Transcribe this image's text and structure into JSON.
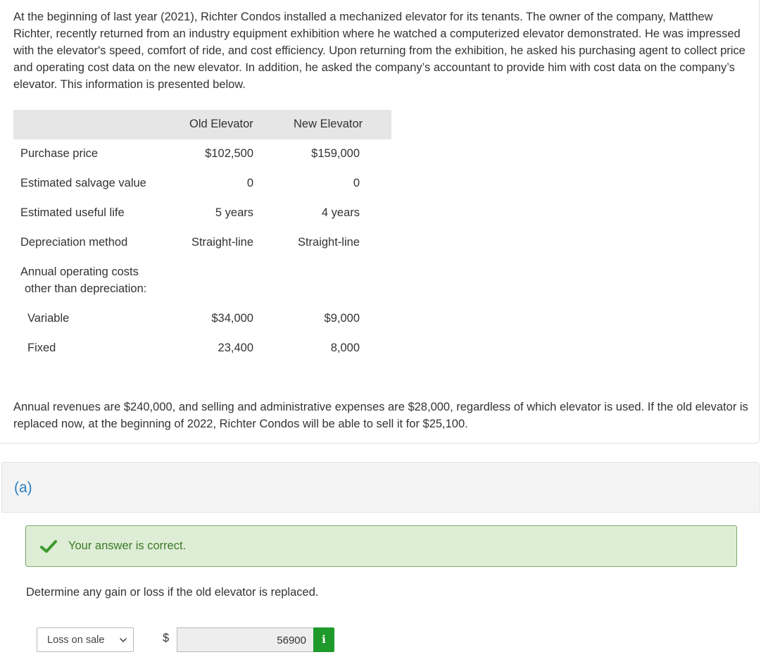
{
  "intro_text": "At the beginning of last year (2021), Richter Condos installed a mechanized elevator for its tenants. The owner of the company, Matthew Richter, recently returned from an industry equipment exhibition where he watched a computerized elevator demonstrated. He was impressed with the elevator's speed, comfort of ride, and cost efficiency. Upon returning from the exhibition, he asked his purchasing agent to collect price and operating cost data on the new elevator. In addition, he asked the company’s accountant to provide him with cost data on the company’s elevator. This information is presented below.",
  "table": {
    "col_old": "Old Elevator",
    "col_new": "New Elevator",
    "rows": [
      {
        "label": "Purchase price",
        "old": "$102,500",
        "new": "$159,000"
      },
      {
        "label": "Estimated salvage value",
        "old": "0",
        "new": "0"
      },
      {
        "label": "Estimated useful life",
        "old": "5 years",
        "new": "4 years"
      },
      {
        "label": "Depreciation method",
        "old": "Straight-line",
        "new": "Straight-line"
      },
      {
        "label": "Annual operating costs",
        "old": "",
        "new": ""
      },
      {
        "label": "other than depreciation:",
        "old": "",
        "new": ""
      },
      {
        "label": "Variable",
        "old": "$34,000",
        "new": "$9,000"
      },
      {
        "label": "Fixed",
        "old": "23,400",
        "new": "8,000"
      }
    ]
  },
  "outro_text": "Annual revenues are $240,000, and selling and administrative expenses are $28,000, regardless of which elevator is used. If the old elevator is replaced now, at the beginning of 2022, Richter Condos will be able to sell it for $25,100.",
  "part": {
    "label": "(a)"
  },
  "feedback": {
    "message": "Your answer is correct.",
    "color": "#3c7a28"
  },
  "question": "Determine any gain or loss if the old elevator is replaced.",
  "answer": {
    "select_value": "Loss on sale",
    "currency": "$",
    "input_value": "56900",
    "info_icon": "i"
  }
}
